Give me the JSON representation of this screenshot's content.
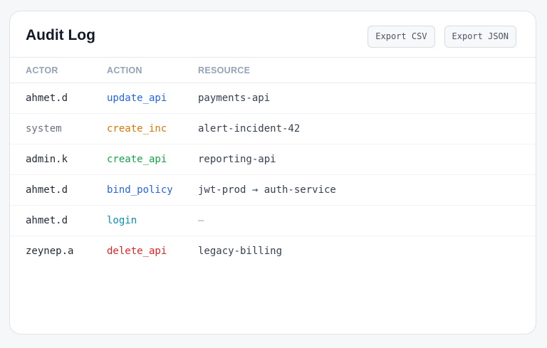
{
  "header": {
    "title": "Audit Log",
    "export_csv_label": "Export CSV",
    "export_json_label": "Export JSON"
  },
  "table": {
    "columns": [
      "ACTOR",
      "ACTION",
      "RESOURCE"
    ],
    "rows": [
      {
        "actor": "ahmet.d",
        "action": "update_api",
        "resource": "payments-api"
      },
      {
        "actor": "system",
        "action": "create_inc",
        "resource": "alert-incident-42"
      },
      {
        "actor": "admin.k",
        "action": "create_api",
        "resource": "reporting-api"
      },
      {
        "actor": "ahmet.d",
        "action": "bind_policy",
        "resource": "jwt-prod → auth-service"
      },
      {
        "actor": "ahmet.d",
        "action": "login",
        "resource": "—"
      },
      {
        "actor": "zeynep.a",
        "action": "delete_api",
        "resource": "legacy-billing"
      }
    ]
  },
  "colors": {
    "update_api": "#2563eb",
    "create_inc": "#d97706",
    "create_api": "#16a34a",
    "bind_policy": "#2563eb",
    "login": "#0891b2",
    "delete_api": "#dc2626",
    "system_actor": "#6b7280"
  }
}
